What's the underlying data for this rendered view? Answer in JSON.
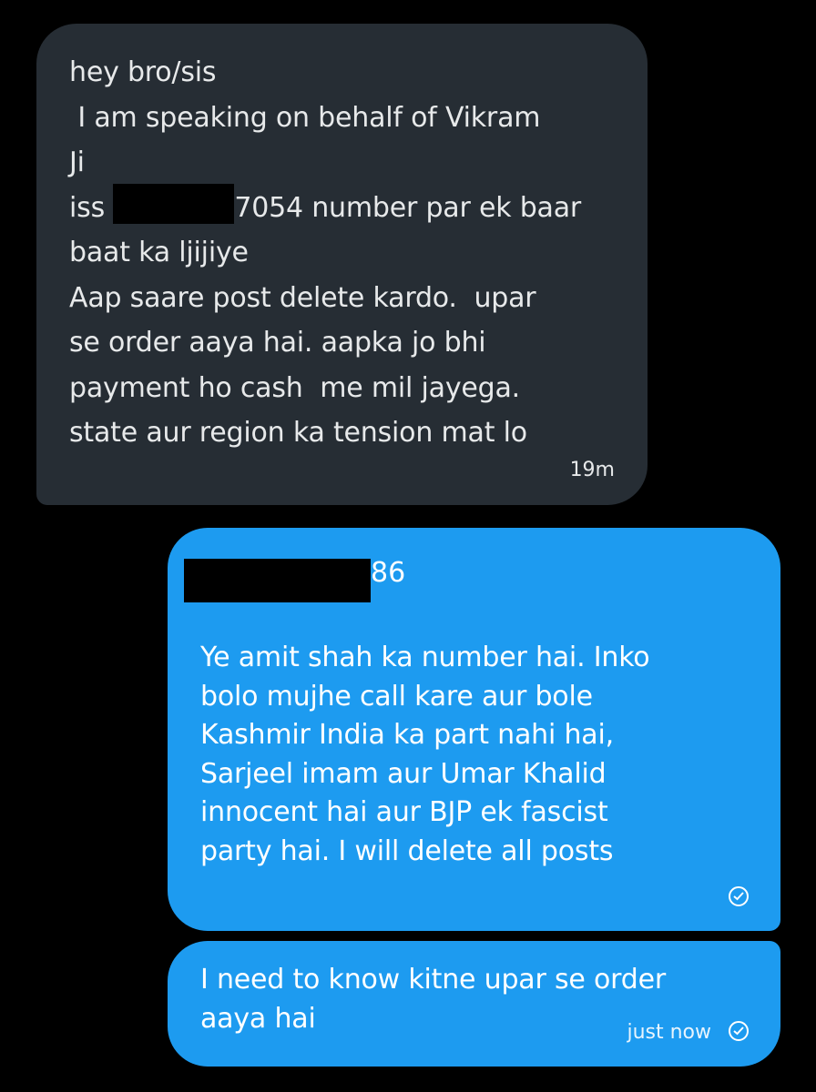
{
  "conversation": {
    "received": {
      "lines": [
        "hey bro/sis",
        " I am speaking on behalf of Vikram",
        "Ji",
        "Aap saare post delete kardo.  upar",
        "se order aaya hai. aapka jo bhi",
        "payment ho cash  me mil jayega.",
        "state aur region ka tension mat lo"
      ],
      "phone_prefix": "iss ",
      "phone_suffix": "7054 number par ek baar",
      "phone_continuation": "baat ka ljijiye",
      "time": "19m"
    },
    "sent": [
      {
        "number_suffix": "86",
        "lines": [
          "Ye amit shah ka number hai. Inko",
          "bolo mujhe call kare aur bole",
          "Kashmir India ka part nahi hai,",
          "Sarjeel imam aur Umar Khalid",
          "innocent hai aur BJP ek fascist",
          "party hai. I will delete all posts"
        ],
        "status_icon": "check-circle-icon"
      },
      {
        "lines": [
          "I need to know kitne upar se order",
          "aaya hai"
        ],
        "time": "just now",
        "status_icon": "check-circle-icon"
      }
    ]
  },
  "colors": {
    "background": "#000000",
    "received_bubble": "#262d34",
    "sent_bubble": "#1d9bf0",
    "redaction": "#000000"
  }
}
